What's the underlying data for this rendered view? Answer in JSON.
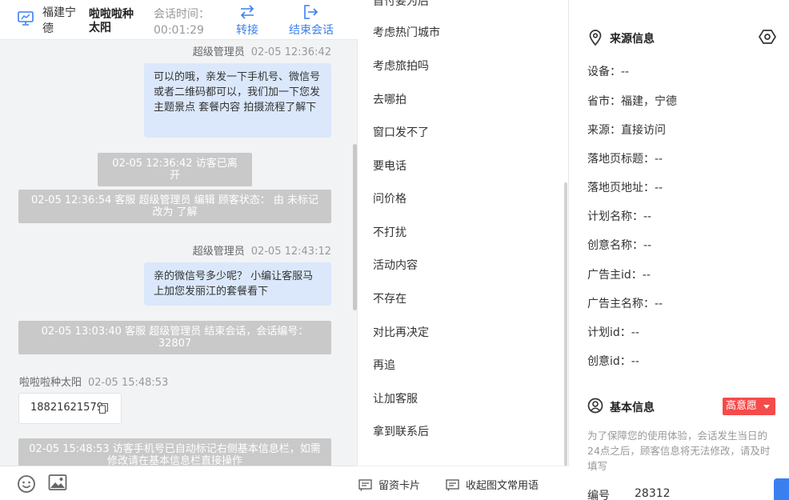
{
  "header": {
    "region": "福建宁德",
    "visitor_name": "啦啦啦种太阳",
    "session_time_label": "会话时间：",
    "session_time": "00:01:29",
    "transfer_label": "转接",
    "end_label": "结束会话"
  },
  "messages": {
    "m1": {
      "sender": "超级管理员",
      "time": "02-05 12:36:42",
      "text": "可以的哦，亲发一下手机号、微信号或者二维码都可以，我们加一下您发主题景点 套餐内容 拍摄流程了解下"
    },
    "s1": "02-05 12:36:42 访客已离开",
    "s2": "02-05 12:36:54 客服 超级管理员 编辑 顾客状态： 由 未标记 改为 了解",
    "m2": {
      "sender": "超级管理员",
      "time": "02-05 12:43:12",
      "text": "亲的微信号多少呢？ 小编让客服马上加您发丽江的套餐看下"
    },
    "s3": "02-05 13:03:40 客服 超级管理员 结束会话，会话编号：32807",
    "m3": {
      "sender": "啦啦啦种太阳",
      "time": "02-05 15:48:53",
      "phone": "18821621579"
    },
    "s4": "02-05 15:48:53 访客手机号已自动标记右侧基本信息栏，如需修改请在基本信息栏直接操作"
  },
  "phrases": {
    "partial": "首付要为后",
    "items": [
      "考虑热门城市",
      "考虑旅拍吗",
      "去哪拍",
      "窗口发不了",
      "要电话",
      "问价格",
      "不打扰",
      "活动内容",
      "不存在",
      "对比再决定",
      "再追",
      "让加客服",
      "拿到联系后"
    ]
  },
  "phrase_footer": {
    "card_label": "留资卡片",
    "common_label": "收起图文常用语"
  },
  "source": {
    "title": "来源信息",
    "rows": [
      "设备：--",
      "省市：福建，宁德",
      "来源：直接访问",
      "落地页标题：--",
      "落地页地址：--",
      "计划名称：--",
      "创意名称：--",
      "广告主id：--",
      "广告主名称：--",
      "计划id：--",
      "创意id：--"
    ]
  },
  "basic": {
    "title": "基本信息",
    "intent": "高意愿",
    "note": "为了保障您的使用体验，会话发生当日的24点之后，顾客信息将无法修改，请及时填写",
    "id_label": "编号",
    "id_value": "28312"
  },
  "colors": {
    "accent": "#3a7ff0",
    "bubble": "#dbe8fb",
    "system_note": "#c9c9c9",
    "intent_badge": "#f44b4b"
  }
}
